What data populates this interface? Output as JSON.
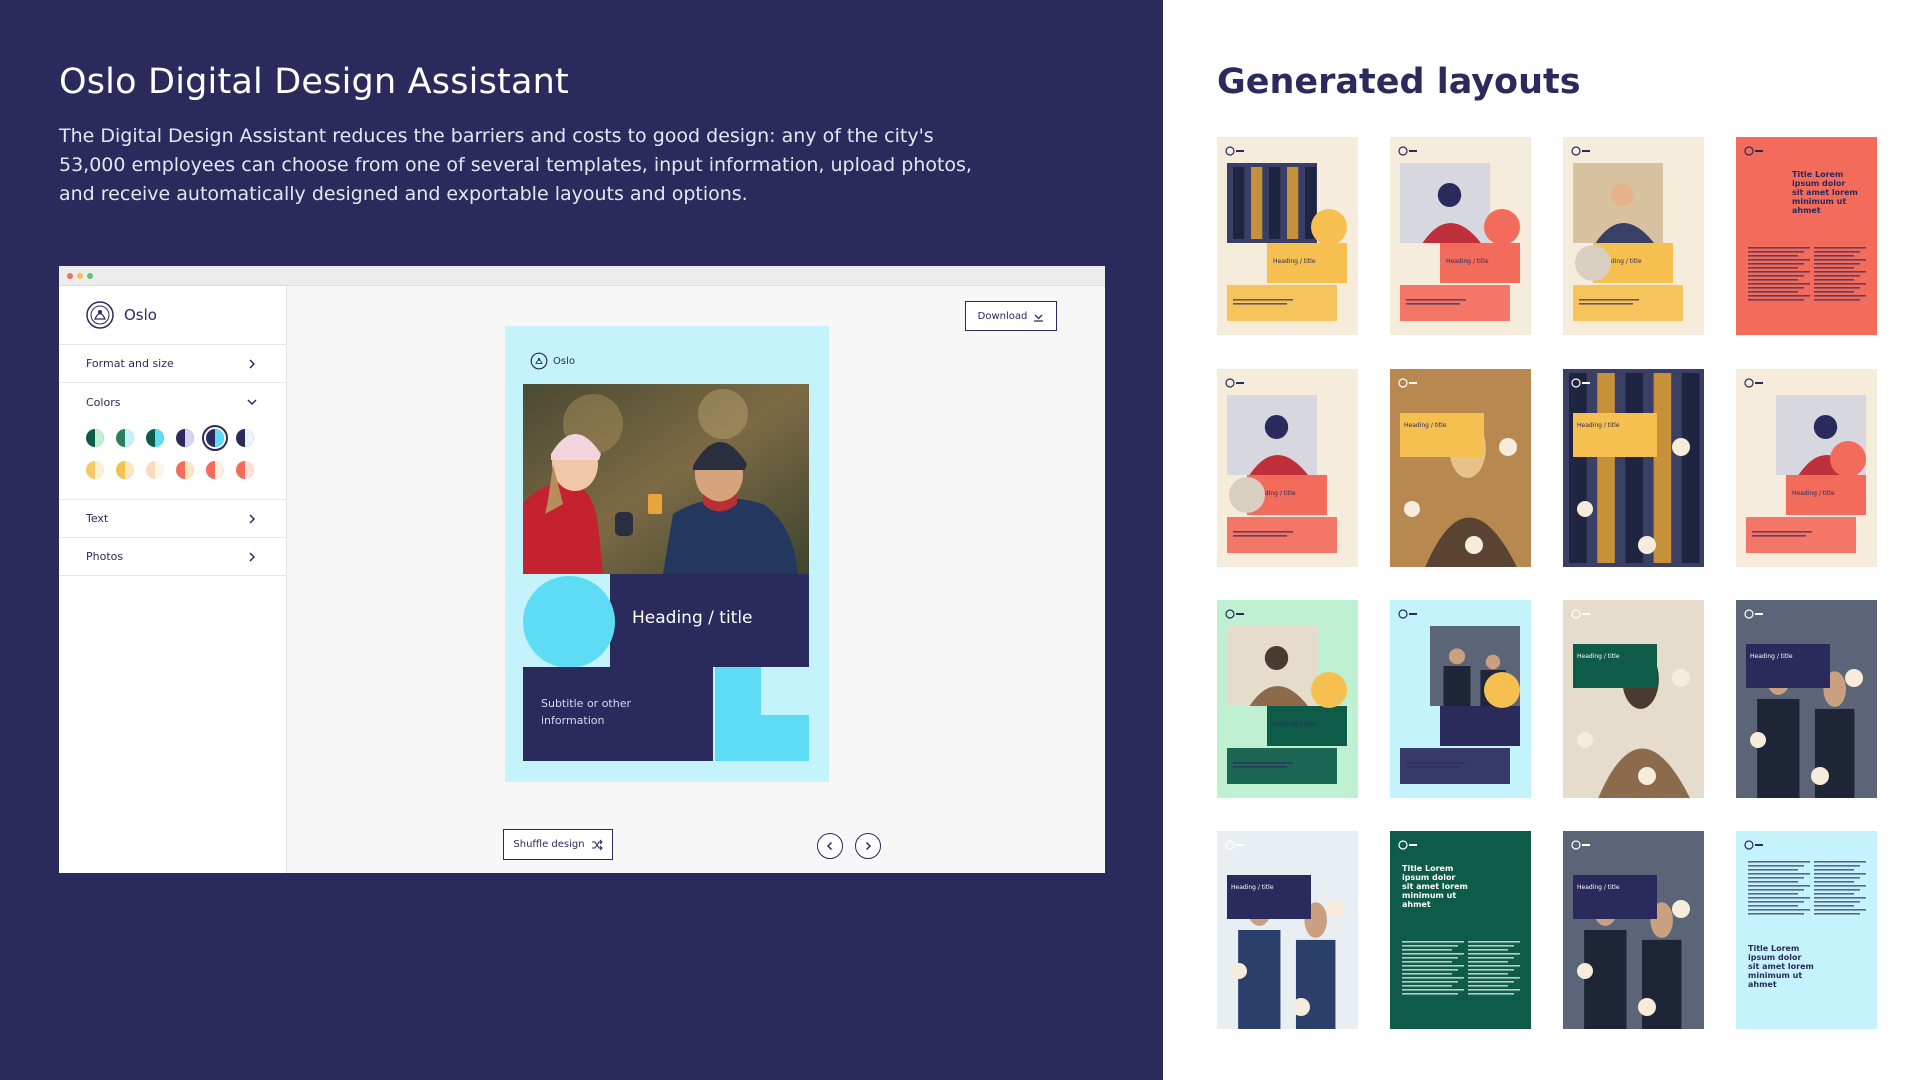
{
  "left": {
    "title": "Oslo Digital Design Assistant",
    "description": "The Digital Design Assistant reduces the barriers and costs to good design: any of the city's 53,000 employees can choose from one of several templates, input information, upload photos, and receive automatically designed and exportable layouts and options."
  },
  "app": {
    "titlebar_dots": [
      "#f26b5b",
      "#f2c14e",
      "#5cc46b"
    ],
    "brand": "Oslo",
    "sidebar": {
      "format_label": "Format and size",
      "colors_label": "Colors",
      "text_label": "Text",
      "photos_label": "Photos"
    },
    "swatches_row1": [
      {
        "a": "#0e5b48",
        "b": "#bff0d2",
        "selected": false
      },
      {
        "a": "#2f7f5f",
        "b": "#c4f3fb",
        "selected": false
      },
      {
        "a": "#0e5b48",
        "b": "#5fdcf5",
        "selected": false
      },
      {
        "a": "#2b2a5c",
        "b": "#d6d4f5",
        "selected": false
      },
      {
        "a": "#2b2a5c",
        "b": "#5fdcf5",
        "selected": true
      },
      {
        "a": "#2b2a5c",
        "b": "#e8f4ff",
        "selected": false
      }
    ],
    "swatches_row2": [
      {
        "a": "#f5c96a",
        "b": "#fdf0d2",
        "selected": false
      },
      {
        "a": "#f2c14e",
        "b": "#fbe6c0",
        "selected": false
      },
      {
        "a": "#f7dcc0",
        "b": "#fff6ea",
        "selected": false
      },
      {
        "a": "#f26b5b",
        "b": "#fbe6c0",
        "selected": false
      },
      {
        "a": "#f26b5b",
        "b": "#f6efe2",
        "selected": false
      },
      {
        "a": "#f26b5b",
        "b": "#fde0dc",
        "selected": false
      }
    ],
    "download_label": "Download",
    "poster": {
      "brand": "Oslo",
      "heading": "Heading / title",
      "subtitle": "Subtitle or other information"
    },
    "shuffle_label": "Shuffle design"
  },
  "right": {
    "title": "Generated layouts"
  },
  "colors": {
    "navy": "#2b2a5c",
    "cyan": "#5fdcf5",
    "light_cyan": "#c4f3fb",
    "coral": "#f26b5b",
    "yellow": "#f5c050",
    "cream": "#f6ecdc",
    "dark_green": "#0e5b48",
    "mint": "#bff0d2"
  },
  "thumbnails": [
    {
      "bg": "#f6ecdc",
      "accent": "#f5c050",
      "photo": "building",
      "variant": "a",
      "heading": "Heading / title"
    },
    {
      "bg": "#f6ecdc",
      "accent": "#f26b5b",
      "photo": "kids",
      "variant": "b",
      "heading": "Heading / title"
    },
    {
      "bg": "#f6ecdc",
      "accent": "#f5c050",
      "photo": "woman",
      "variant": "c",
      "heading": "Heading / title"
    },
    {
      "bg": "#f26b5b",
      "accent": "#2b2a5c",
      "photo": "none",
      "variant": "text",
      "heading": "Title Lorem ipsum dolor sit amet lorem minimum ut ahmet"
    },
    {
      "bg": "#f6ecdc",
      "accent": "#f26b5b",
      "photo": "kids",
      "variant": "c",
      "heading": "Heading / title"
    },
    {
      "bg": "#c7935a",
      "accent": "#f5c050",
      "photo": "man",
      "variant": "full",
      "heading": "Heading / title"
    },
    {
      "bg": "#2b2a5c",
      "accent": "#f5c050",
      "photo": "building",
      "variant": "full",
      "heading": "Heading / title"
    },
    {
      "bg": "#f6ecdc",
      "accent": "#f26b5b",
      "photo": "kids",
      "variant": "d",
      "heading": "Heading / title"
    },
    {
      "bg": "#bff0d2",
      "accent": "#0e5b48",
      "photo": "outdoor",
      "variant": "a",
      "heading": "Heading / title"
    },
    {
      "bg": "#c4f3fb",
      "accent": "#2b2a5c",
      "photo": "men",
      "variant": "d",
      "heading": "Heading / title"
    },
    {
      "bg": "#e8e0d4",
      "accent": "#0e5b48",
      "photo": "outdoor",
      "variant": "full",
      "heading": "Heading / title"
    },
    {
      "bg": "#4b5566",
      "accent": "#2b2a5c",
      "photo": "men",
      "variant": "full",
      "heading": "Heading / title"
    },
    {
      "bg": "#e6eef2",
      "accent": "#2b2a5c",
      "photo": "snow",
      "variant": "full",
      "heading": "Heading / title"
    },
    {
      "bg": "#0e5b48",
      "accent": "#ffffff",
      "photo": "none",
      "variant": "text",
      "heading": "Title Lorem ipsum dolor sit amet lorem minimum ut ahmet"
    },
    {
      "bg": "#4b5566",
      "accent": "#2b2a5c",
      "photo": "men",
      "variant": "full",
      "heading": "Heading / title"
    },
    {
      "bg": "#c4f3fb",
      "accent": "#2b2a5c",
      "photo": "none",
      "variant": "text2",
      "heading": "Title Lorem ipsum dolor sit amet lorem minimum ut ahmet"
    }
  ]
}
